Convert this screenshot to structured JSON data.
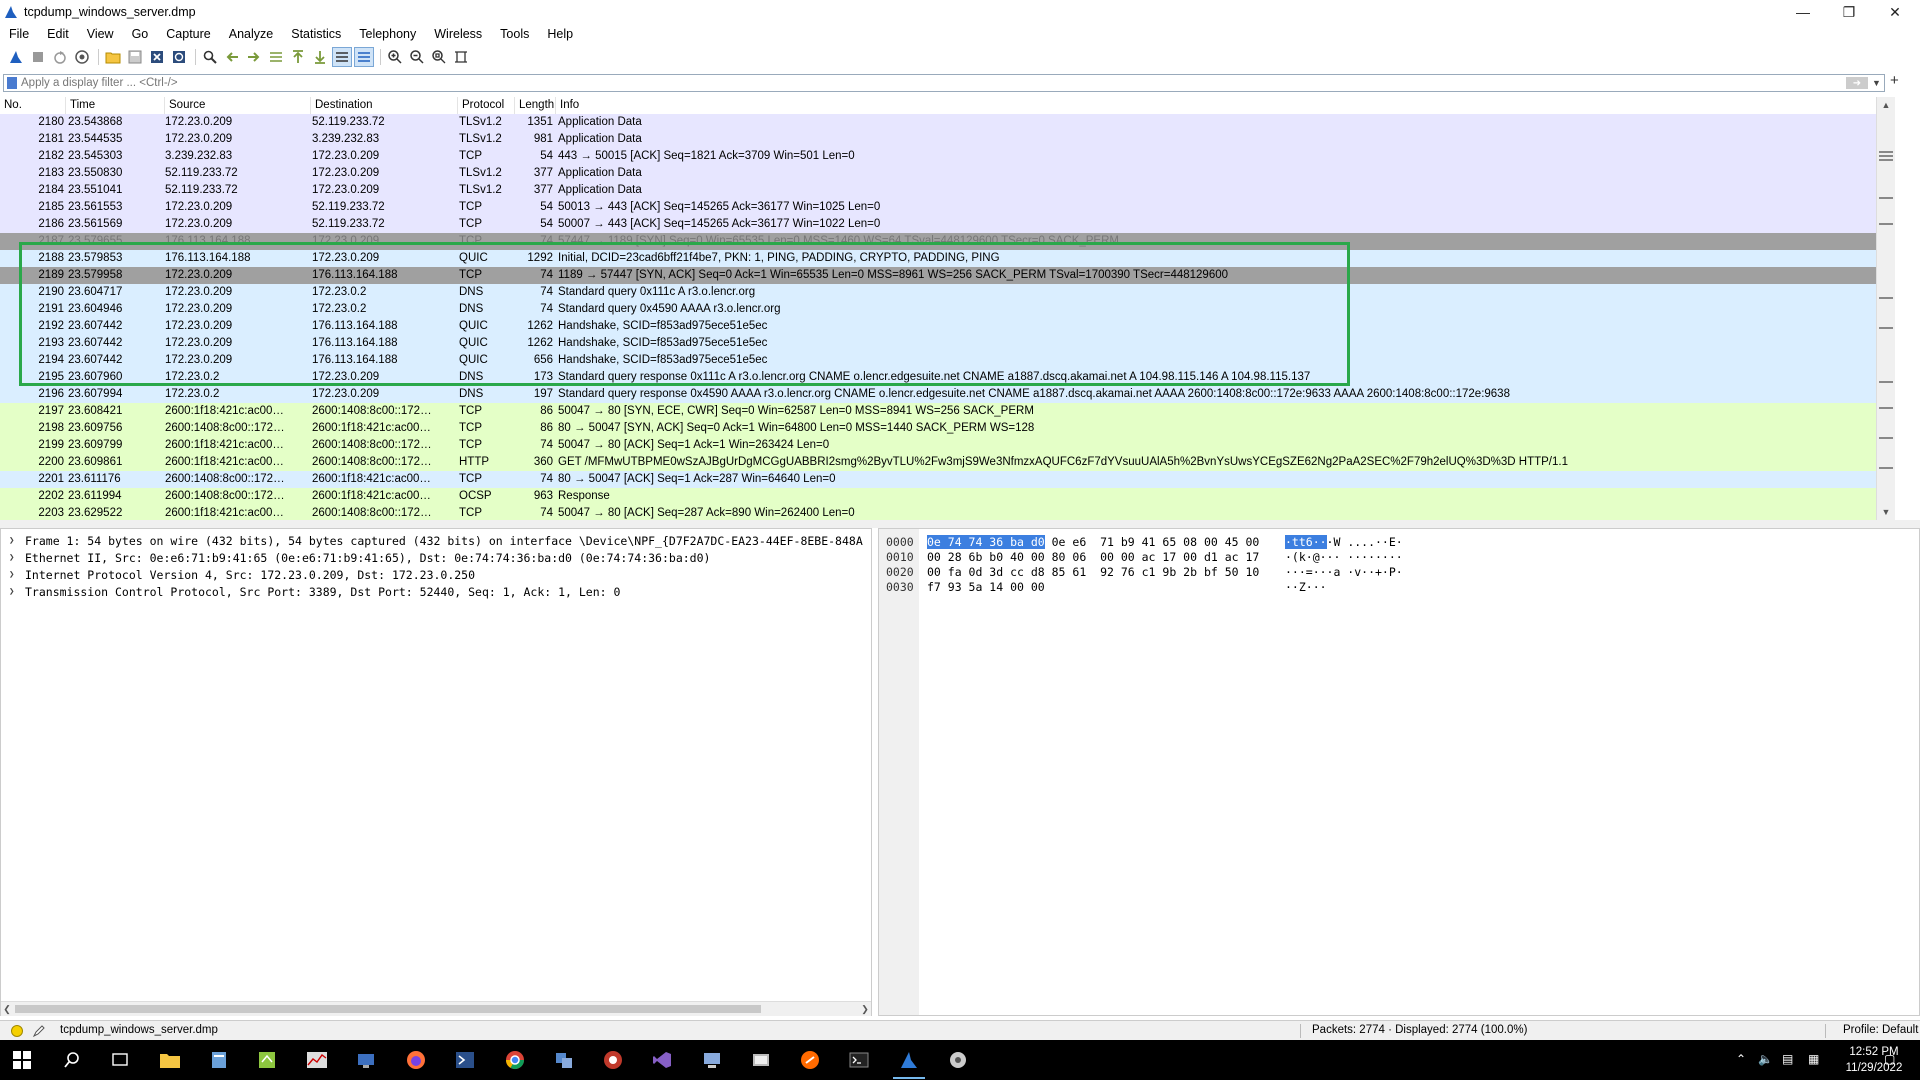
{
  "window": {
    "title": "tcpdump_windows_server.dmp"
  },
  "menu": [
    "File",
    "Edit",
    "View",
    "Go",
    "Capture",
    "Analyze",
    "Statistics",
    "Telephony",
    "Wireless",
    "Tools",
    "Help"
  ],
  "filter": {
    "placeholder": "Apply a display filter ... <Ctrl-/>",
    "value": ""
  },
  "columns": [
    "No.",
    "Time",
    "Source",
    "Destination",
    "Protocol",
    "Length",
    "Info"
  ],
  "colors": {
    "tls": "#e7e6ff",
    "tcp_err": "#a0a0a0",
    "quic": "#daeeff",
    "dns": "#daeeff",
    "http": "#e4ffc7",
    "selected": "#a0a0a0",
    "green_box": "#2aa84a",
    "hex_highlight": "#3c7fe0"
  },
  "packets": [
    {
      "no": "2180",
      "time": "23.543868",
      "src": "172.23.0.209",
      "dst": "52.119.233.72",
      "proto": "TLSv1.2",
      "len": "1351",
      "info": "Application Data",
      "bg": "#e7e6ff"
    },
    {
      "no": "2181",
      "time": "23.544535",
      "src": "172.23.0.209",
      "dst": "3.239.232.83",
      "proto": "TLSv1.2",
      "len": "981",
      "info": "Application Data",
      "bg": "#e7e6ff"
    },
    {
      "no": "2182",
      "time": "23.545303",
      "src": "3.239.232.83",
      "dst": "172.23.0.209",
      "proto": "TCP",
      "len": "54",
      "info": "443 → 50015 [ACK] Seq=1821 Ack=3709 Win=501 Len=0",
      "bg": "#e7e6ff"
    },
    {
      "no": "2183",
      "time": "23.550830",
      "src": "52.119.233.72",
      "dst": "172.23.0.209",
      "proto": "TLSv1.2",
      "len": "377",
      "info": "Application Data",
      "bg": "#e7e6ff"
    },
    {
      "no": "2184",
      "time": "23.551041",
      "src": "52.119.233.72",
      "dst": "172.23.0.209",
      "proto": "TLSv1.2",
      "len": "377",
      "info": "Application Data",
      "bg": "#e7e6ff"
    },
    {
      "no": "2185",
      "time": "23.561553",
      "src": "172.23.0.209",
      "dst": "52.119.233.72",
      "proto": "TCP",
      "len": "54",
      "info": "50013 → 443 [ACK] Seq=145265 Ack=36177 Win=1025 Len=0",
      "bg": "#e7e6ff"
    },
    {
      "no": "2186",
      "time": "23.561569",
      "src": "172.23.0.209",
      "dst": "52.119.233.72",
      "proto": "TCP",
      "len": "54",
      "info": "50007 → 443 [ACK] Seq=145265 Ack=36177 Win=1022 Len=0",
      "bg": "#e7e6ff"
    },
    {
      "no": "2187",
      "time": "23.579655",
      "src": "176.113.164.188",
      "dst": "172.23.0.209",
      "proto": "TCP",
      "len": "74",
      "info": "57447 → 1189 [SYN] Seq=0 Win=65535 Len=0 MSS=1460 WS=64 TSval=448129600 TSecr=0 SACK_PERM",
      "bg": "#a0a0a0",
      "fg": "#777"
    },
    {
      "no": "2188",
      "time": "23.579853",
      "src": "176.113.164.188",
      "dst": "172.23.0.209",
      "proto": "QUIC",
      "len": "1292",
      "info": "Initial, DCID=23cad6bff21f4be7, PKN: 1, PING, PADDING, CRYPTO, PADDING, PING",
      "bg": "#daeeff"
    },
    {
      "no": "2189",
      "time": "23.579958",
      "src": "172.23.0.209",
      "dst": "176.113.164.188",
      "proto": "TCP",
      "len": "74",
      "info": "1189 → 57447 [SYN, ACK] Seq=0 Ack=1 Win=65535 Len=0 MSS=8961 WS=256 SACK_PERM TSval=1700390 TSecr=448129600",
      "bg": "#a0a0a0"
    },
    {
      "no": "2190",
      "time": "23.604717",
      "src": "172.23.0.209",
      "dst": "172.23.0.2",
      "proto": "DNS",
      "len": "74",
      "info": "Standard query 0x111c A r3.o.lencr.org",
      "bg": "#daeeff"
    },
    {
      "no": "2191",
      "time": "23.604946",
      "src": "172.23.0.209",
      "dst": "172.23.0.2",
      "proto": "DNS",
      "len": "74",
      "info": "Standard query 0x4590 AAAA r3.o.lencr.org",
      "bg": "#daeeff"
    },
    {
      "no": "2192",
      "time": "23.607442",
      "src": "172.23.0.209",
      "dst": "176.113.164.188",
      "proto": "QUIC",
      "len": "1262",
      "info": "Handshake, SCID=f853ad975ece51e5ec",
      "bg": "#daeeff"
    },
    {
      "no": "2193",
      "time": "23.607442",
      "src": "172.23.0.209",
      "dst": "176.113.164.188",
      "proto": "QUIC",
      "len": "1262",
      "info": "Handshake, SCID=f853ad975ece51e5ec",
      "bg": "#daeeff"
    },
    {
      "no": "2194",
      "time": "23.607442",
      "src": "172.23.0.209",
      "dst": "176.113.164.188",
      "proto": "QUIC",
      "len": "656",
      "info": "Handshake, SCID=f853ad975ece51e5ec",
      "bg": "#daeeff"
    },
    {
      "no": "2195",
      "time": "23.607960",
      "src": "172.23.0.2",
      "dst": "172.23.0.209",
      "proto": "DNS",
      "len": "173",
      "info": "Standard query response 0x111c A r3.o.lencr.org CNAME o.lencr.edgesuite.net CNAME a1887.dscq.akamai.net A 104.98.115.146 A 104.98.115.137",
      "bg": "#daeeff"
    },
    {
      "no": "2196",
      "time": "23.607994",
      "src": "172.23.0.2",
      "dst": "172.23.0.209",
      "proto": "DNS",
      "len": "197",
      "info": "Standard query response 0x4590 AAAA r3.o.lencr.org CNAME o.lencr.edgesuite.net CNAME a1887.dscq.akamai.net AAAA 2600:1408:8c00::172e:9633 AAAA 2600:1408:8c00::172e:9638",
      "bg": "#daeeff"
    },
    {
      "no": "2197",
      "time": "23.608421",
      "src": "2600:1f18:421c:ac00…",
      "dst": "2600:1408:8c00::172…",
      "proto": "TCP",
      "len": "86",
      "info": "50047 → 80 [SYN, ECE, CWR] Seq=0 Win=62587 Len=0 MSS=8941 WS=256 SACK_PERM",
      "bg": "#e4ffc7"
    },
    {
      "no": "2198",
      "time": "23.609756",
      "src": "2600:1408:8c00::172…",
      "dst": "2600:1f18:421c:ac00…",
      "proto": "TCP",
      "len": "86",
      "info": "80 → 50047 [SYN, ACK] Seq=0 Ack=1 Win=64800 Len=0 MSS=1440 SACK_PERM WS=128",
      "bg": "#e4ffc7"
    },
    {
      "no": "2199",
      "time": "23.609799",
      "src": "2600:1f18:421c:ac00…",
      "dst": "2600:1408:8c00::172…",
      "proto": "TCP",
      "len": "74",
      "info": "50047 → 80 [ACK] Seq=1 Ack=1 Win=263424 Len=0",
      "bg": "#e4ffc7"
    },
    {
      "no": "2200",
      "time": "23.609861",
      "src": "2600:1f18:421c:ac00…",
      "dst": "2600:1408:8c00::172…",
      "proto": "HTTP",
      "len": "360",
      "info": "GET /MFMwUTBPME0wSzAJBgUrDgMCGgUABBRI2smg%2ByvTLU%2Fw3mjS9We3NfmzxAQUFC6zF7dYVsuuUAlA5h%2BvnYsUwsYCEgSZE62Ng2PaA2SEC%2F79h2elUQ%3D%3D HTTP/1.1",
      "bg": "#e4ffc7"
    },
    {
      "no": "2201",
      "time": "23.611176",
      "src": "2600:1408:8c00::172…",
      "dst": "2600:1f18:421c:ac00…",
      "proto": "TCP",
      "len": "74",
      "info": "80 → 50047 [ACK] Seq=1 Ack=287 Win=64640 Len=0",
      "bg": "#daeeff"
    },
    {
      "no": "2202",
      "time": "23.611994",
      "src": "2600:1408:8c00::172…",
      "dst": "2600:1f18:421c:ac00…",
      "proto": "OCSP",
      "len": "963",
      "info": "Response",
      "bg": "#e4ffc7"
    },
    {
      "no": "2203",
      "time": "23.629522",
      "src": "2600:1f18:421c:ac00…",
      "dst": "2600:1408:8c00::172…",
      "proto": "TCP",
      "len": "74",
      "info": "50047 → 80 [ACK] Seq=287 Ack=890 Win=262400 Len=0",
      "bg": "#e4ffc7"
    }
  ],
  "details": [
    "Frame 1: 54 bytes on wire (432 bits), 54 bytes captured (432 bits) on interface \\Device\\NPF_{D7F2A7DC-EA23-44EF-8EBE-848A",
    "Ethernet II, Src: 0e:e6:71:b9:41:65 (0e:e6:71:b9:41:65), Dst: 0e:74:74:36:ba:d0 (0e:74:74:36:ba:d0)",
    "Internet Protocol Version 4, Src: 172.23.0.209, Dst: 172.23.0.250",
    "Transmission Control Protocol, Src Port: 3389, Dst Port: 52440, Seq: 1, Ack: 1, Len: 0"
  ],
  "hex": [
    {
      "off": "0000",
      "hl": "0e 74 74 36 ba d0",
      "bytes": " 0e e6  71 b9 41 65 08 00 45 00",
      "ahl": "·tt6··",
      "ascii": "·W ....··E·"
    },
    {
      "off": "0010",
      "hl": "",
      "bytes": "00 28 6b b0 40 00 80 06  00 00 ac 17 00 d1 ac 17",
      "ahl": "",
      "ascii": "·(k·@··· ········"
    },
    {
      "off": "0020",
      "hl": "",
      "bytes": "00 fa 0d 3d cc d8 85 61  92 76 c1 9b 2b bf 50 10",
      "ahl": "",
      "ascii": "···=···a ·v··+·P·"
    },
    {
      "off": "0030",
      "hl": "",
      "bytes": "f7 93 5a 14 00 00",
      "ahl": "",
      "ascii": "··Z···"
    }
  ],
  "status": {
    "file": "tcpdump_windows_server.dmp",
    "packets": "Packets: 2774 · Displayed: 2774 (100.0%)",
    "profile": "Profile: Default"
  },
  "clock": {
    "time": "12:52 PM",
    "date": "11/29/2022"
  }
}
